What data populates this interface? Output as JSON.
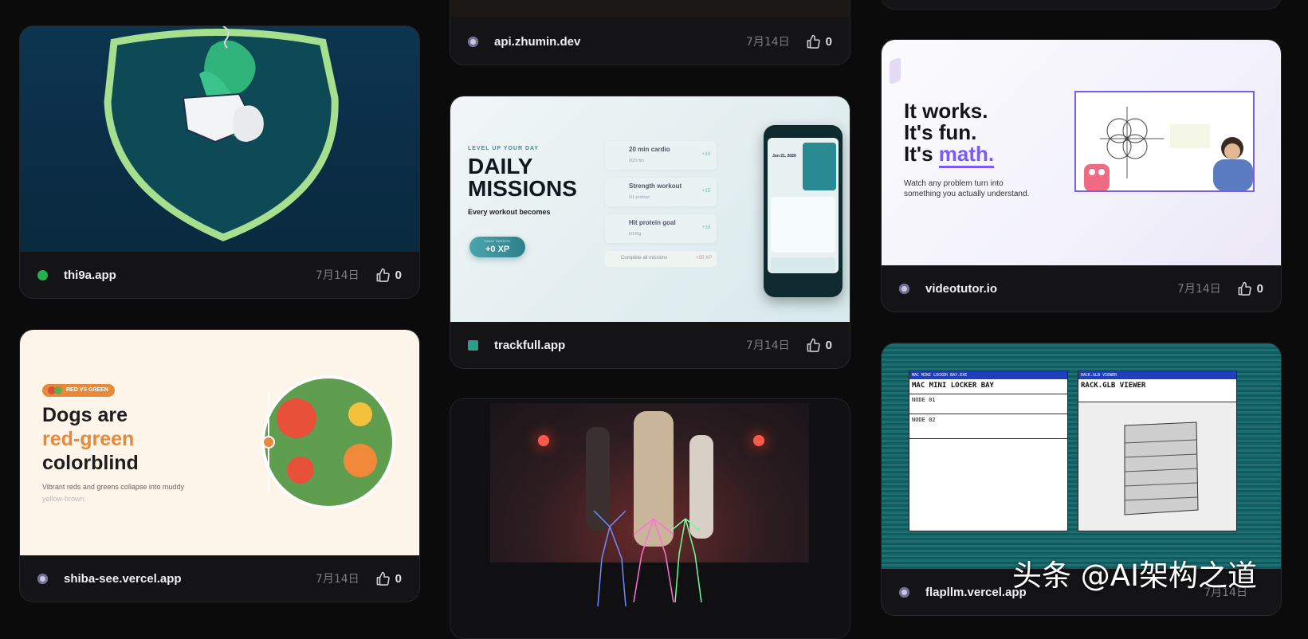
{
  "cards": {
    "top_partial": {
      "domain": "api.zhumin.dev",
      "date": "7月14日",
      "likes": "0"
    },
    "thi9a": {
      "domain": "thi9a.app",
      "date": "7月14日",
      "likes": "0"
    },
    "videotutor": {
      "domain": "videotutor.io",
      "date": "7月14日",
      "likes": "0",
      "preview": {
        "line1": "It works.",
        "line2": "It's fun.",
        "line3_prefix": "It's ",
        "line3_accent": "math.",
        "sub1": "Watch any problem turn into",
        "sub2": "something you actually understand."
      }
    },
    "trackfull": {
      "domain": "trackfull.app",
      "date": "7月14日",
      "likes": "0",
      "preview": {
        "kicker": "LEVEL UP YOUR DAY",
        "title1": "DAILY",
        "title2": "MISSIONS",
        "tagline": "Every workout becomes",
        "xp_small": "TODAY TARGETS",
        "xp": "+0 XP",
        "missions": [
          {
            "name": "20 min cardio",
            "sub": "0/20 min",
            "xp": "+10"
          },
          {
            "name": "Strength workout",
            "sub": "0/1 workout",
            "xp": "+15"
          },
          {
            "name": "Hit protein goal",
            "sub": "0/140g",
            "xp": "+10"
          }
        ],
        "complete_all": "Complete all missions",
        "complete_xp": "+50 XP",
        "phone_date": "Jun 21, 2026"
      }
    },
    "shiba": {
      "domain": "shiba-see.vercel.app",
      "date": "7月14日",
      "likes": "0",
      "preview": {
        "badge": "RED VS GREEN",
        "h1": "Dogs are",
        "h2": "red-green",
        "h3": "colorblind",
        "p1": "Vibrant reds and greens collapse into muddy",
        "p2": "yellow-brown."
      }
    },
    "dance": {},
    "flapllm": {
      "domain": "flapllm.vercel.app",
      "date": "7月14日",
      "likes": "",
      "preview": {
        "win1_bar": "MAC MINI LOCKER BAY.EXE",
        "win1_title": "MAC MINI LOCKER BAY",
        "node1": "NODE 01",
        "node2": "NODE 02",
        "win2_bar": "RACK.GLB VIEWER",
        "win2_title": "RACK.GLB VIEWER"
      }
    }
  },
  "watermark": "头条 @AI架构之道",
  "colors": {
    "accent_purple": "#7b5cf0",
    "orange": "#e8893a",
    "dog_green": "#5e9e4e",
    "teal": "#3b8f96"
  }
}
